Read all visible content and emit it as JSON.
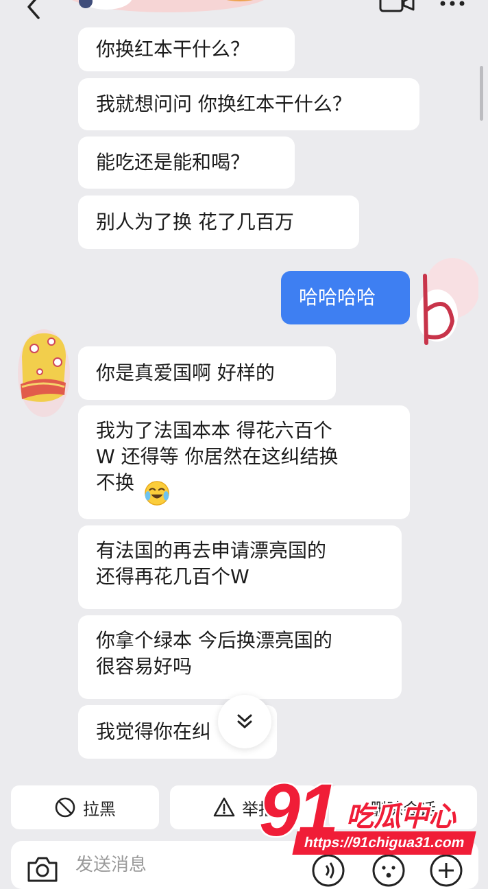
{
  "messages_received_top": [
    "你换红本干什么？",
    "我就想问问 你换红本干什么？",
    "能吃还是能和喝？",
    "别人为了换 花了几百万"
  ],
  "message_sent": "哈哈哈哈",
  "messages_received_bottom": [
    "你是真爱国啊 好样的",
    "我为了法国本本 得花六百个\nW 还得等 你居然在这纠结换\n不换",
    "有法国的再去申请漂亮国的\n还得再花几百个W",
    "你拿个绿本 今后换漂亮国的\n很容易好吗",
    "我觉得你在纠"
  ],
  "actions": {
    "block_label": "拉黑",
    "report_label": "举报",
    "delete_label": "删除会话"
  },
  "input": {
    "placeholder": "发送消息"
  },
  "watermark": {
    "number": "91",
    "title": "吃瓜中心",
    "url": "https://91chigua31.com"
  },
  "icons": {
    "back": "chevron-left-icon",
    "video": "video-camera-icon",
    "more": "more-dots-icon",
    "block": "ban-icon",
    "report": "warning-triangle-icon",
    "camera": "camera-icon",
    "voice": "voice-icon",
    "emoji": "emoji-icon",
    "plus": "plus-icon",
    "scroll": "double-chevron-down-icon"
  },
  "colors": {
    "sent_bubble": "#3e7ff2",
    "received_bubble": "#ffffff",
    "background": "#ebebee",
    "watermark": "#f01d37"
  }
}
